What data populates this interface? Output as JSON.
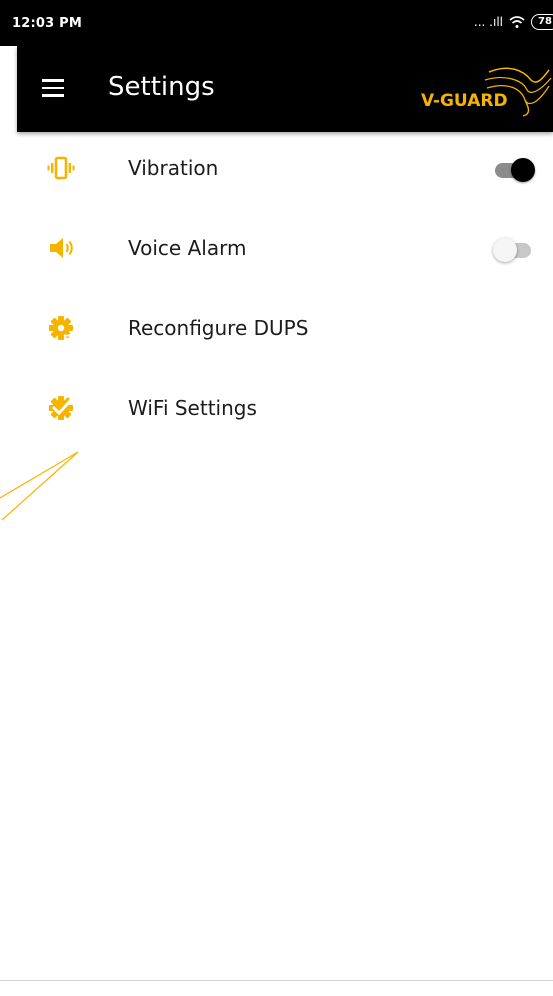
{
  "status_bar": {
    "time": "12:03 PM",
    "signal_text": "... .ıll",
    "battery": "78"
  },
  "app_bar": {
    "title": "Settings",
    "brand": "V-GUARD"
  },
  "colors": {
    "accent": "#F5B400",
    "bar_background": "#000000",
    "toggle_on": "#000000",
    "toggle_off": "#F5F5F5"
  },
  "settings": [
    {
      "label": "Vibration",
      "icon": "vibration-icon",
      "toggle": true,
      "enabled": true
    },
    {
      "label": "Voice Alarm",
      "icon": "speaker-icon",
      "toggle": true,
      "enabled": false
    },
    {
      "label": "Reconfigure DUPS",
      "icon": "gear-icon",
      "toggle": false
    },
    {
      "label": "WiFi Settings",
      "icon": "gear-check-icon",
      "toggle": false
    }
  ]
}
